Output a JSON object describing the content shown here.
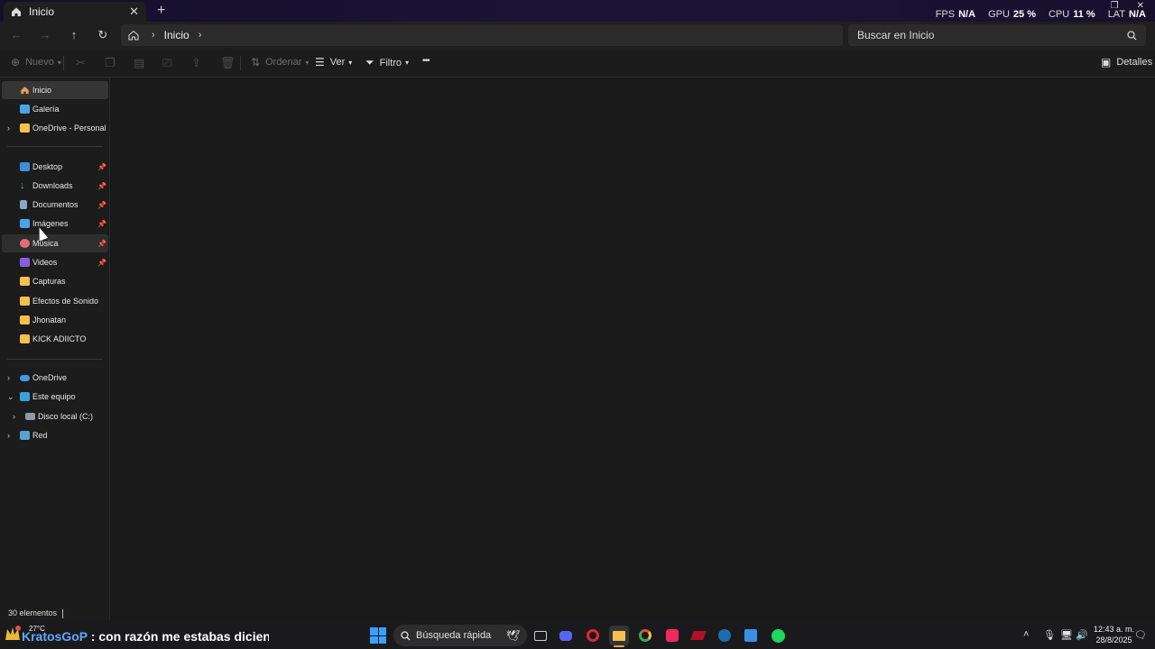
{
  "tab": {
    "label": "Inicio",
    "close": "✕",
    "new": "+"
  },
  "perf": {
    "fps_label": "FPS",
    "fps_value": "N/A",
    "gpu_label": "GPU",
    "gpu_value": "25 %",
    "cpu_label": "CPU",
    "cpu_value": "11 %",
    "lat_label": "LAT",
    "lat_value": "N/A"
  },
  "address": {
    "crumb": "Inicio"
  },
  "search": {
    "placeholder": "Buscar en Inicio"
  },
  "toolbar": {
    "new_label": "Nuevo",
    "sort_label": "Ordenar",
    "view_label": "Ver",
    "filter_label": "Filtro",
    "more_label": "•••",
    "details_label": "Detalles"
  },
  "sidebar": {
    "items": [
      {
        "label": "Inicio"
      },
      {
        "label": "Galería"
      },
      {
        "label": "OneDrive - Personal"
      },
      {
        "label": "Desktop"
      },
      {
        "label": "Downloads"
      },
      {
        "label": "Documentos"
      },
      {
        "label": "Imágenes"
      },
      {
        "label": "Música"
      },
      {
        "label": "Videos"
      },
      {
        "label": "Capturas"
      },
      {
        "label": "Efectos de Sonido"
      },
      {
        "label": "Jhonatan"
      },
      {
        "label": "KICK ADIICTO"
      },
      {
        "label": "OneDrive"
      },
      {
        "label": "Este equipo"
      },
      {
        "label": "Disco local (C:)"
      },
      {
        "label": "Red"
      }
    ]
  },
  "status": {
    "count": "30 elementos"
  },
  "taskbar": {
    "temperature": "27°C",
    "chat_user": "KratosGoP",
    "chat_message": ": con razón me estabas diciendo",
    "search_placeholder": "Búsqueda rápida",
    "time": "12:43 a. m.",
    "date": "28/8/2025"
  },
  "colors": {
    "accent": "#3aa0ff",
    "folder": "#f2c14e",
    "chat_user": "#61a7ff"
  }
}
